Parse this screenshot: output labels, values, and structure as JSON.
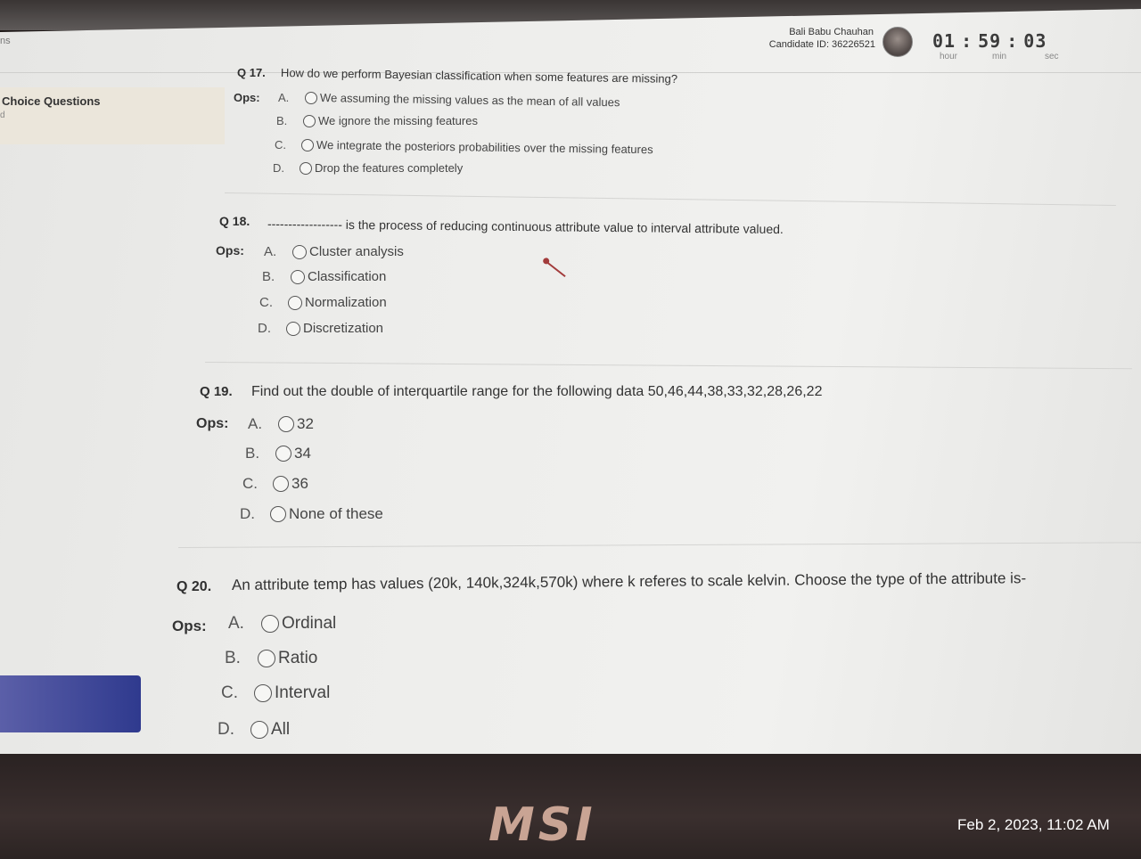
{
  "header": {
    "nav_stub": "ns",
    "user_name": "Bali Babu Chauhan",
    "candidate_id": "Candidate ID: 36226521",
    "timer": {
      "hour": "01",
      "min": "59",
      "sec": "03",
      "sep": ":",
      "hour_label": "hour",
      "min_label": "min",
      "sec_label": "sec"
    }
  },
  "sidebar": {
    "title": "Choice Questions",
    "sub": "d"
  },
  "questions": [
    {
      "num": "Q 17.",
      "text": "How do we perform Bayesian classification when some features are missing?",
      "ops_label": "Ops:",
      "options": [
        {
          "letter": "A.",
          "text": "We assuming the missing values as the mean of all values"
        },
        {
          "letter": "B.",
          "text": "We ignore the missing features"
        },
        {
          "letter": "C.",
          "text": "We integrate the posteriors probabilities over the missing features"
        },
        {
          "letter": "D.",
          "text": "Drop the features completely"
        }
      ]
    },
    {
      "num": "Q 18.",
      "text": "------------------ is the process of reducing continuous attribute value to interval attribute valued.",
      "ops_label": "Ops:",
      "options": [
        {
          "letter": "A.",
          "text": "Cluster analysis"
        },
        {
          "letter": "B.",
          "text": "Classification"
        },
        {
          "letter": "C.",
          "text": "Normalization"
        },
        {
          "letter": "D.",
          "text": "Discretization"
        }
      ]
    },
    {
      "num": "Q 19.",
      "text": "Find out the double of interquartile range for the following data 50,46,44,38,33,32,28,26,22",
      "ops_label": "Ops:",
      "options": [
        {
          "letter": "A.",
          "text": "32"
        },
        {
          "letter": "B.",
          "text": "34"
        },
        {
          "letter": "C.",
          "text": "36"
        },
        {
          "letter": "D.",
          "text": "None of these"
        }
      ]
    },
    {
      "num": "Q 20.",
      "text": "An attribute temp has values (20k, 140k,324k,570k) where k referes to scale kelvin. Choose the type of the attribute is-",
      "ops_label": "Ops:",
      "options": [
        {
          "letter": "A.",
          "text": "Ordinal"
        },
        {
          "letter": "B.",
          "text": "Ratio"
        },
        {
          "letter": "C.",
          "text": "Interval"
        },
        {
          "letter": "D.",
          "text": "All"
        }
      ]
    }
  ],
  "laptop": {
    "brand": "MSI",
    "photo_timestamp": "Feb 2, 2023, 11:02 AM"
  }
}
